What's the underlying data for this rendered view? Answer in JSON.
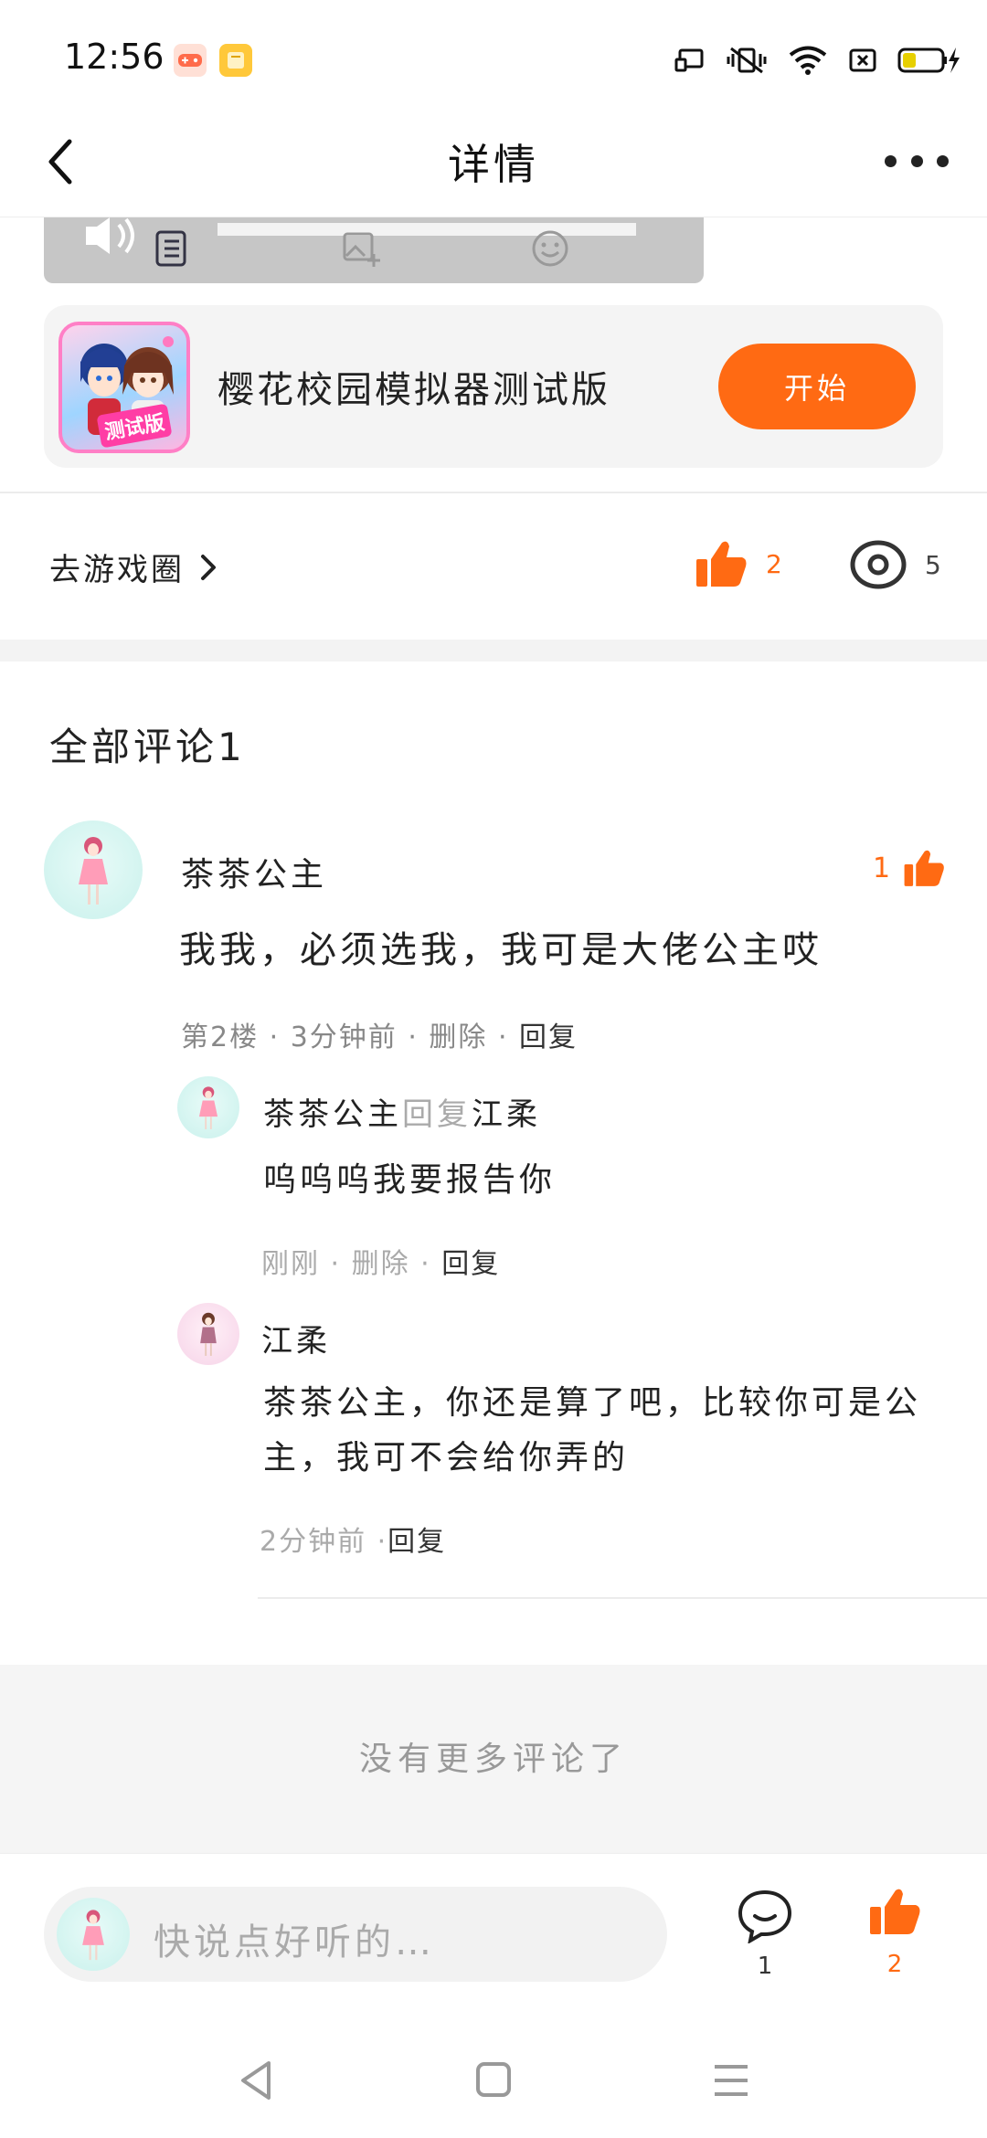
{
  "status_bar": {
    "time": "12:56"
  },
  "header": {
    "title": "详情"
  },
  "game_card": {
    "name": "樱花校园模拟器测试版",
    "thumb_badge": "测试版",
    "start_label": "开始"
  },
  "actions": {
    "go_circle_label": "去游戏圈",
    "like_count": "2",
    "view_count": "5"
  },
  "comments": {
    "title": "全部评论1",
    "items": [
      {
        "user": "茶茶公主",
        "like_count": "1",
        "text": "我我，必须选我，我可是大佬公主哎",
        "floor": "第2楼",
        "time": "3分钟前",
        "delete": "删除",
        "reply": "回复",
        "replies": [
          {
            "user": "茶茶公主",
            "reply_word": "回复",
            "target": "江柔",
            "text": "呜呜呜我要报告你",
            "time": "刚刚",
            "delete": "删除",
            "reply": "回复"
          },
          {
            "user": "江柔",
            "text_line1": "茶茶公主，你还是算了吧，比较你可是公",
            "text_line2": "主，我可不会给你弄的",
            "time": "2分钟前",
            "reply": "回复"
          }
        ]
      }
    ],
    "no_more": "没有更多评论了"
  },
  "bottom_bar": {
    "placeholder": "快说点好听的…",
    "comment_count": "1",
    "like_count": "2"
  },
  "colors": {
    "accent": "#ff6a13",
    "band": "#f3f3f3"
  },
  "icons": [
    "back-arrow-icon",
    "more-dots-icon",
    "thumbs-up-icon",
    "eye-icon",
    "chevron-right-icon",
    "chat-bubble-icon",
    "nav-back-icon",
    "nav-home-icon",
    "nav-menu-icon"
  ]
}
